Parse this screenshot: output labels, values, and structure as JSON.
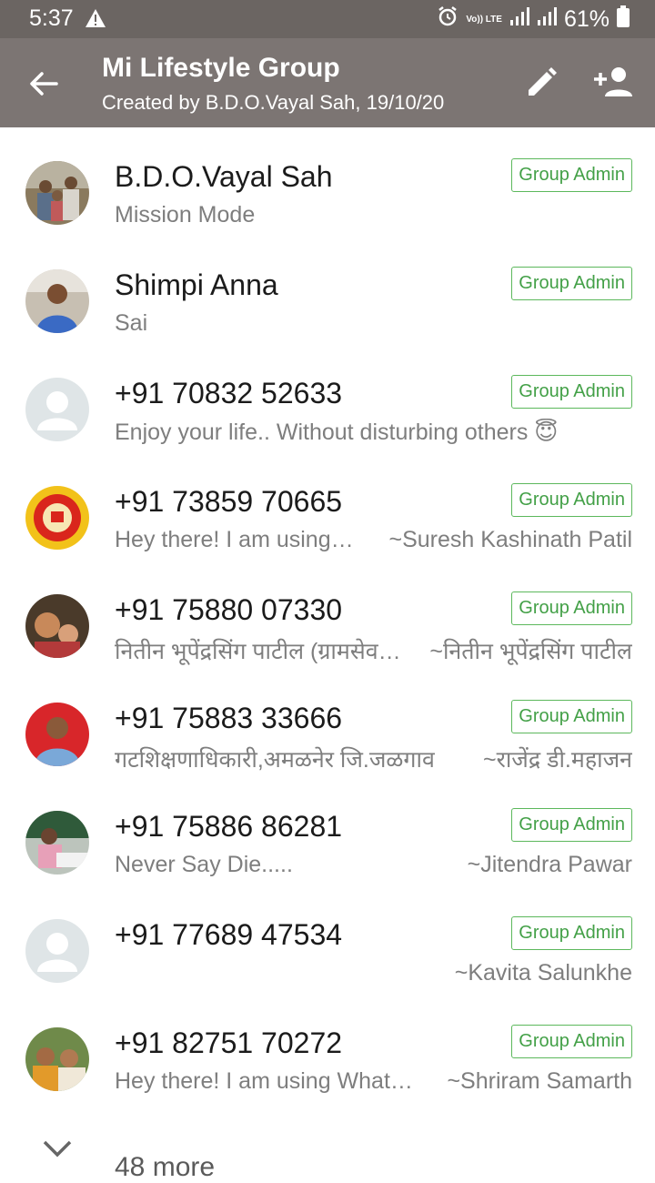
{
  "status_bar": {
    "time": "5:37",
    "volte": "Vo)) LTE",
    "battery": "61%",
    "icons": [
      "warning-icon",
      "alarm-icon",
      "volte-icon",
      "signal-icon",
      "signal-icon",
      "battery-icon"
    ]
  },
  "header": {
    "title": "Mi Lifestyle Group",
    "subtitle": "Created by B.D.O.Vayal Sah, 19/10/20",
    "icons": [
      "back-arrow-icon",
      "pencil-icon",
      "add-person-icon"
    ]
  },
  "colors": {
    "status_bar": "#6b6562",
    "app_bar": "#7c7573",
    "admin_badge": "#43a047"
  },
  "participants": [
    {
      "name": "B.D.O.Vayal Sah",
      "about": "Mission Mode",
      "push_name": "",
      "badge": "Group Admin"
    },
    {
      "name": "Shimpi Anna",
      "about": "Sai",
      "push_name": "",
      "badge": "Group Admin"
    },
    {
      "name": "+91 70832 52633",
      "about": "Enjoy your life.. Without disturbing others 😇",
      "push_name": "",
      "badge": "Group Admin"
    },
    {
      "name": "+91 73859 70665",
      "about": "Hey there! I am using…",
      "push_name": "~Suresh Kashinath Patil",
      "badge": "Group Admin"
    },
    {
      "name": "+91 75880 07330",
      "about": "नितीन भूपेंद्रसिंग पाटील (ग्रामसेव…",
      "push_name": "~नितीन भूपेंद्रसिंग पाटील",
      "badge": "Group Admin"
    },
    {
      "name": "+91 75883 33666",
      "about": "गटशिक्षणाधिकारी,अमळनेर जि.जळगाव",
      "push_name": "~राजेंद्र डी.महाजन",
      "badge": "Group Admin"
    },
    {
      "name": "+91 75886 86281",
      "about": "Never Say Die.....",
      "push_name": "~Jitendra Pawar",
      "badge": "Group Admin"
    },
    {
      "name": "+91 77689 47534",
      "about": "",
      "push_name": "~Kavita Salunkhe",
      "badge": "Group Admin"
    },
    {
      "name": "+91 82751 70272",
      "about": "Hey there! I am using What…",
      "push_name": "~Shriram Samarth",
      "badge": "Group Admin"
    }
  ],
  "more": {
    "label": "48 more"
  }
}
